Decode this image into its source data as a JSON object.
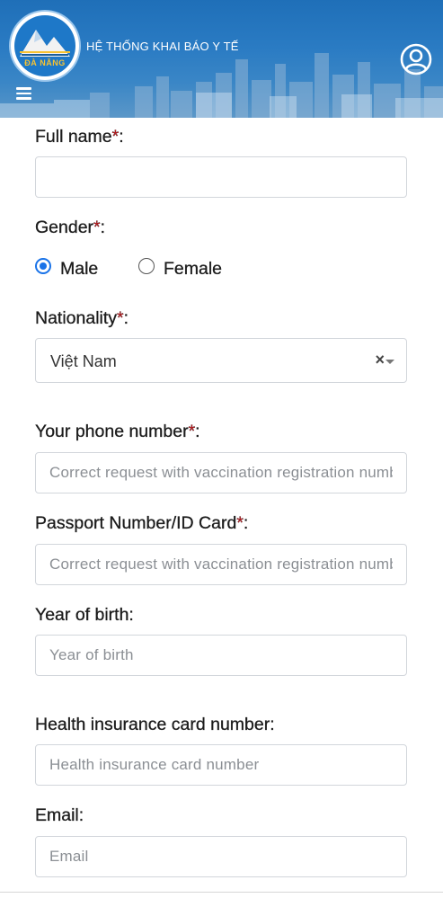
{
  "header": {
    "title": "HỆ THỐNG KHAI BÁO Y TẾ",
    "logo_text": "ĐÀ NẴNG",
    "menu_icon": "hamburger-menu-icon",
    "user_icon": "user-account-icon"
  },
  "form": {
    "full_name": {
      "label": "Full name",
      "required_mark": "*",
      "suffix": ":",
      "value": ""
    },
    "gender": {
      "label": "Gender",
      "required_mark": "*",
      "suffix": ":",
      "options": [
        {
          "label": "Male",
          "selected": true
        },
        {
          "label": "Female",
          "selected": false
        }
      ]
    },
    "nationality": {
      "label": "Nationality",
      "required_mark": "*",
      "suffix": ":",
      "value": "Việt Nam",
      "clear_symbol": "×"
    },
    "phone": {
      "label": "Your phone number",
      "required_mark": "*",
      "suffix": ":",
      "placeholder": "Correct request with vaccination registration number"
    },
    "passport": {
      "label": "Passport Number/ID Card",
      "required_mark": "*",
      "suffix": ":",
      "placeholder": "Correct request with vaccination registration number"
    },
    "year_of_birth": {
      "label": "Year of birth:",
      "placeholder": "Year of birth"
    },
    "health_insurance": {
      "label": "Health insurance card number:",
      "placeholder": "Health insurance card number"
    },
    "email": {
      "label": "Email:",
      "placeholder": "Email"
    }
  },
  "colors": {
    "header_blue": "#2a7bc3",
    "required_red": "#d4161c",
    "radio_blue": "#1a73e8"
  }
}
